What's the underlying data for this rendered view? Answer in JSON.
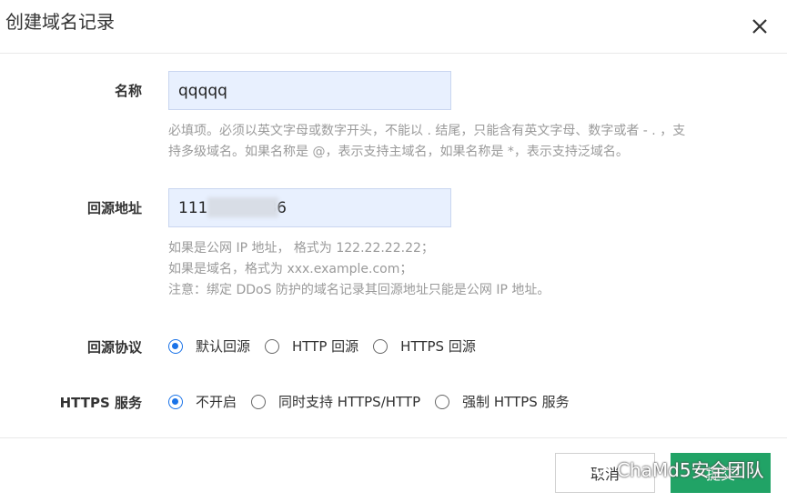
{
  "dialog": {
    "title": "创建域名记录",
    "close_icon": "close-icon"
  },
  "form": {
    "name": {
      "label": "名称",
      "value": "qqqqq",
      "help": [
        "必填项。必须以英文字母或数字开头，不能以 . 结尾，只能含有英文字母、数字或者 - . ，支",
        "持多级域名。如果名称是 @，表示支持主域名，如果名称是 *，表示支持泛域名。"
      ]
    },
    "origin": {
      "label": "回源地址",
      "value": "111           .86",
      "help": [
        "如果是公网 IP 地址， 格式为 122.22.22.22；",
        "如果是域名，格式为 xxx.example.com；",
        "注意：绑定 DDoS 防护的域名记录其回源地址只能是公网 IP 地址。"
      ]
    },
    "protocol": {
      "label": "回源协议",
      "options": [
        "默认回源",
        "HTTP 回源",
        "HTTPS 回源"
      ],
      "selected": 0
    },
    "https_service": {
      "label": "HTTPS 服务",
      "options": [
        "不开启",
        "同时支持 HTTPS/HTTP",
        "强制 HTTPS 服务"
      ],
      "selected": 0
    }
  },
  "footer": {
    "cancel_label": "取消",
    "ok_label": "提交"
  },
  "watermark": {
    "text": "ChaMd5安全团队"
  },
  "colors": {
    "accent": "#1a73e8",
    "primary_button": "#21a366",
    "input_bg": "#e8f0fe"
  }
}
